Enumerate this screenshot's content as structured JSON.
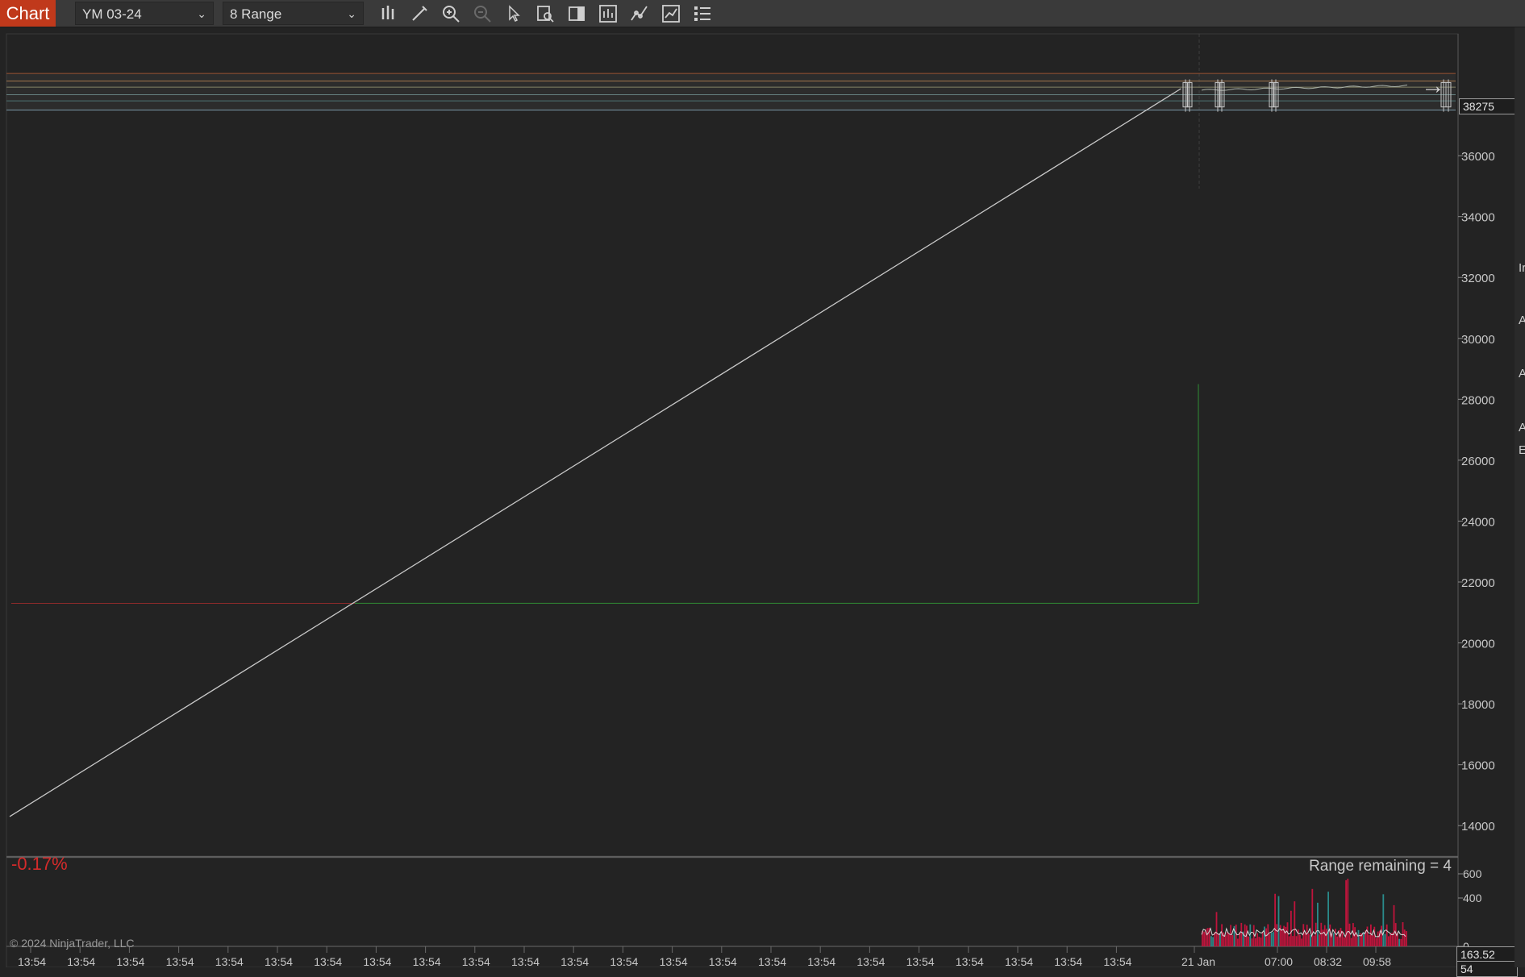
{
  "toolbar": {
    "chart_tab": "Chart",
    "instrument": "YM 03-24",
    "bar_type": "8 Range",
    "icons": [
      "bars-type-icon",
      "draw-pencil-icon",
      "zoom-in-icon",
      "zoom-out-icon",
      "pointer-icon",
      "data-box-icon",
      "chart-trader-icon",
      "strategies-icon",
      "indicators-icon",
      "templates-icon",
      "properties-icon"
    ]
  },
  "chart": {
    "last_price_tag": "38275",
    "scroll_arrow": "→",
    "percent_change": "-0.17%",
    "range_remaining": "Range remaining = 4",
    "copyright": "© 2024 NinjaTrader, LLC",
    "volume_tag_1": "163.52",
    "volume_tag_2": "54",
    "colors": {
      "background": "#232323",
      "down": "#d42b2b",
      "up": "#2e7d32",
      "volume_red": "#c0143c",
      "volume_teal": "#2a8b8b"
    }
  },
  "chart_data": {
    "type": "line",
    "price_axis": {
      "ticks": [
        14000,
        16000,
        18000,
        20000,
        22000,
        24000,
        26000,
        28000,
        30000,
        32000,
        34000,
        36000
      ],
      "range": [
        13000,
        40000
      ]
    },
    "volume_axis": {
      "ticks": [
        0,
        400,
        600
      ],
      "range": [
        0,
        720
      ]
    },
    "time_ticks": [
      "13:54",
      "13:54",
      "13:54",
      "13:54",
      "13:54",
      "13:54",
      "13:54",
      "13:54",
      "13:54",
      "13:54",
      "13:54",
      "13:54",
      "13:54",
      "13:54",
      "13:54",
      "13:54",
      "13:54",
      "13:54",
      "13:54",
      "13:54",
      "13:54",
      "13:54",
      "13:54",
      "21 Jan",
      "07:00",
      "08:32",
      "09:58"
    ],
    "series": [
      {
        "x": [
          0,
          0.81
        ],
        "y": [
          14300,
          38200
        ]
      }
    ],
    "reference_lines": [
      21300,
      38700,
      38450,
      38250,
      38000,
      37800,
      37500
    ]
  },
  "right_panel": {
    "letters": [
      "Ir",
      "A",
      "A",
      "A",
      "E"
    ]
  }
}
